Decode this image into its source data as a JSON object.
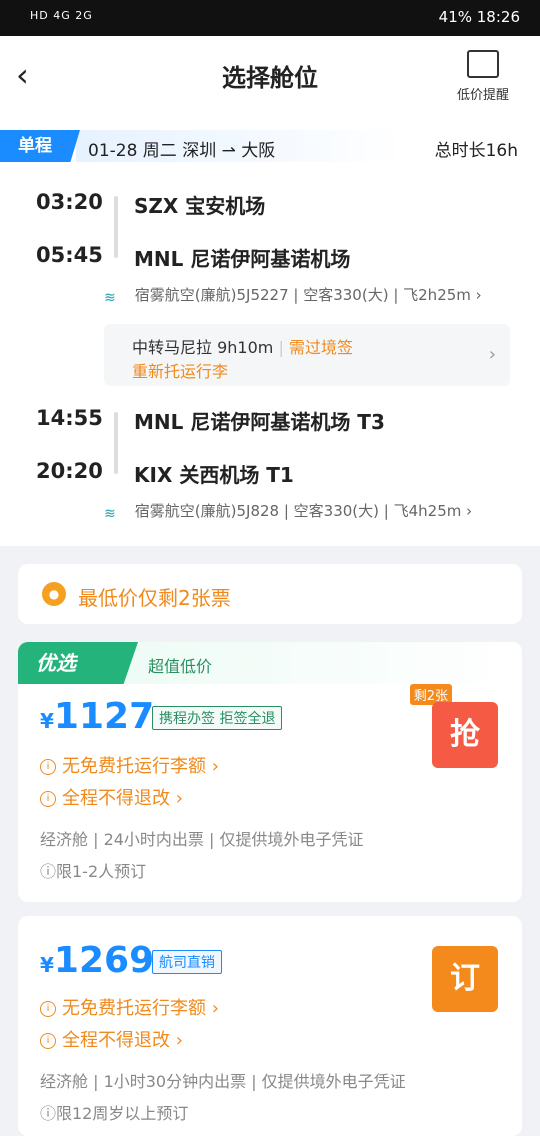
{
  "status_bar": {
    "left": "HD 4G 2G",
    "right": "41%  18:26"
  },
  "header": {
    "title": "选择舱位",
    "back_icon": "chevron-left-icon",
    "alert_label": "低价提醒"
  },
  "trip": {
    "tag": "单程",
    "text": "01-28 周二 深圳 ⇀ 大阪",
    "duration": "总时长16h"
  },
  "segments": [
    {
      "dep_time": "03:20",
      "dep_airport": "SZX 宝安机场",
      "arr_time": "05:45",
      "arr_airport": "MNL 尼诺伊阿基诺机场",
      "info": "宿雾航空(廉航)5J5227 | 空客330(大) | 飞2h25m ›"
    },
    {
      "dep_time": "14:55",
      "dep_airport": "MNL 尼诺伊阿基诺机场 T3",
      "arr_time": "20:20",
      "arr_airport": "KIX 关西机场 T1",
      "info": "宿雾航空(廉航)5J828 | 空客330(大) | 飞4h25m ›"
    }
  ],
  "transfer": {
    "line1": "中转马尼拉 9h10m",
    "visa": "需过境签",
    "line2": "重新托运行李"
  },
  "warning": {
    "text": "最低价仅剩2张票"
  },
  "offers": [
    {
      "tag": "优选",
      "subtitle": "超值低价",
      "currency": "¥",
      "price": "1127",
      "badge": "携程办签 拒签全退",
      "notes": [
        "无免费托运行李额 ›",
        "全程不得退改 ›"
      ],
      "meta": "经济舱 | 24小时内出票 | 仅提供境外电子凭证",
      "limit": "ⓘ限1-2人预订",
      "remain": "剩2张",
      "button": "抢"
    },
    {
      "currency": "¥",
      "price": "1269",
      "badge": "航司直销",
      "notes": [
        "无免费托运行李额 ›",
        "全程不得退改 ›"
      ],
      "meta": "经济舱 | 1小时30分钟内出票 | 仅提供境外电子凭证",
      "limit": "ⓘ限12周岁以上预订",
      "button": "订"
    }
  ]
}
